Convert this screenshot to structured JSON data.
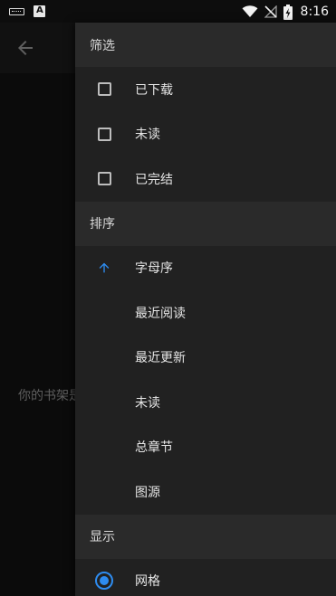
{
  "status_bar": {
    "time": "8:16",
    "left_icons": [
      "keyboard-icon",
      "a-notification-icon"
    ],
    "right_icons": [
      "wifi-icon",
      "no-signal-icon",
      "battery-charging-icon"
    ]
  },
  "background": {
    "back_icon": "arrow-left-icon",
    "empty_text": "你的书架是"
  },
  "drawer": {
    "filter": {
      "header": "筛选",
      "items": [
        {
          "label": "已下载",
          "control": "checkbox",
          "checked": false
        },
        {
          "label": "未读",
          "control": "checkbox",
          "checked": false
        },
        {
          "label": "已完结",
          "control": "checkbox",
          "checked": false
        }
      ]
    },
    "sort": {
      "header": "排序",
      "items": [
        {
          "label": "字母序",
          "active": true,
          "icon": "arrow-up-icon"
        },
        {
          "label": "最近阅读"
        },
        {
          "label": "最近更新"
        },
        {
          "label": "未读"
        },
        {
          "label": "总章节"
        },
        {
          "label": "图源"
        }
      ]
    },
    "display": {
      "header": "显示",
      "items": [
        {
          "label": "网格",
          "control": "radio",
          "selected": true
        }
      ]
    }
  },
  "colors": {
    "accent": "#2e8cf0",
    "drawer_bg": "#212121",
    "header_bg": "#2a2a2a",
    "screen_bg": "#0b0b0b"
  }
}
